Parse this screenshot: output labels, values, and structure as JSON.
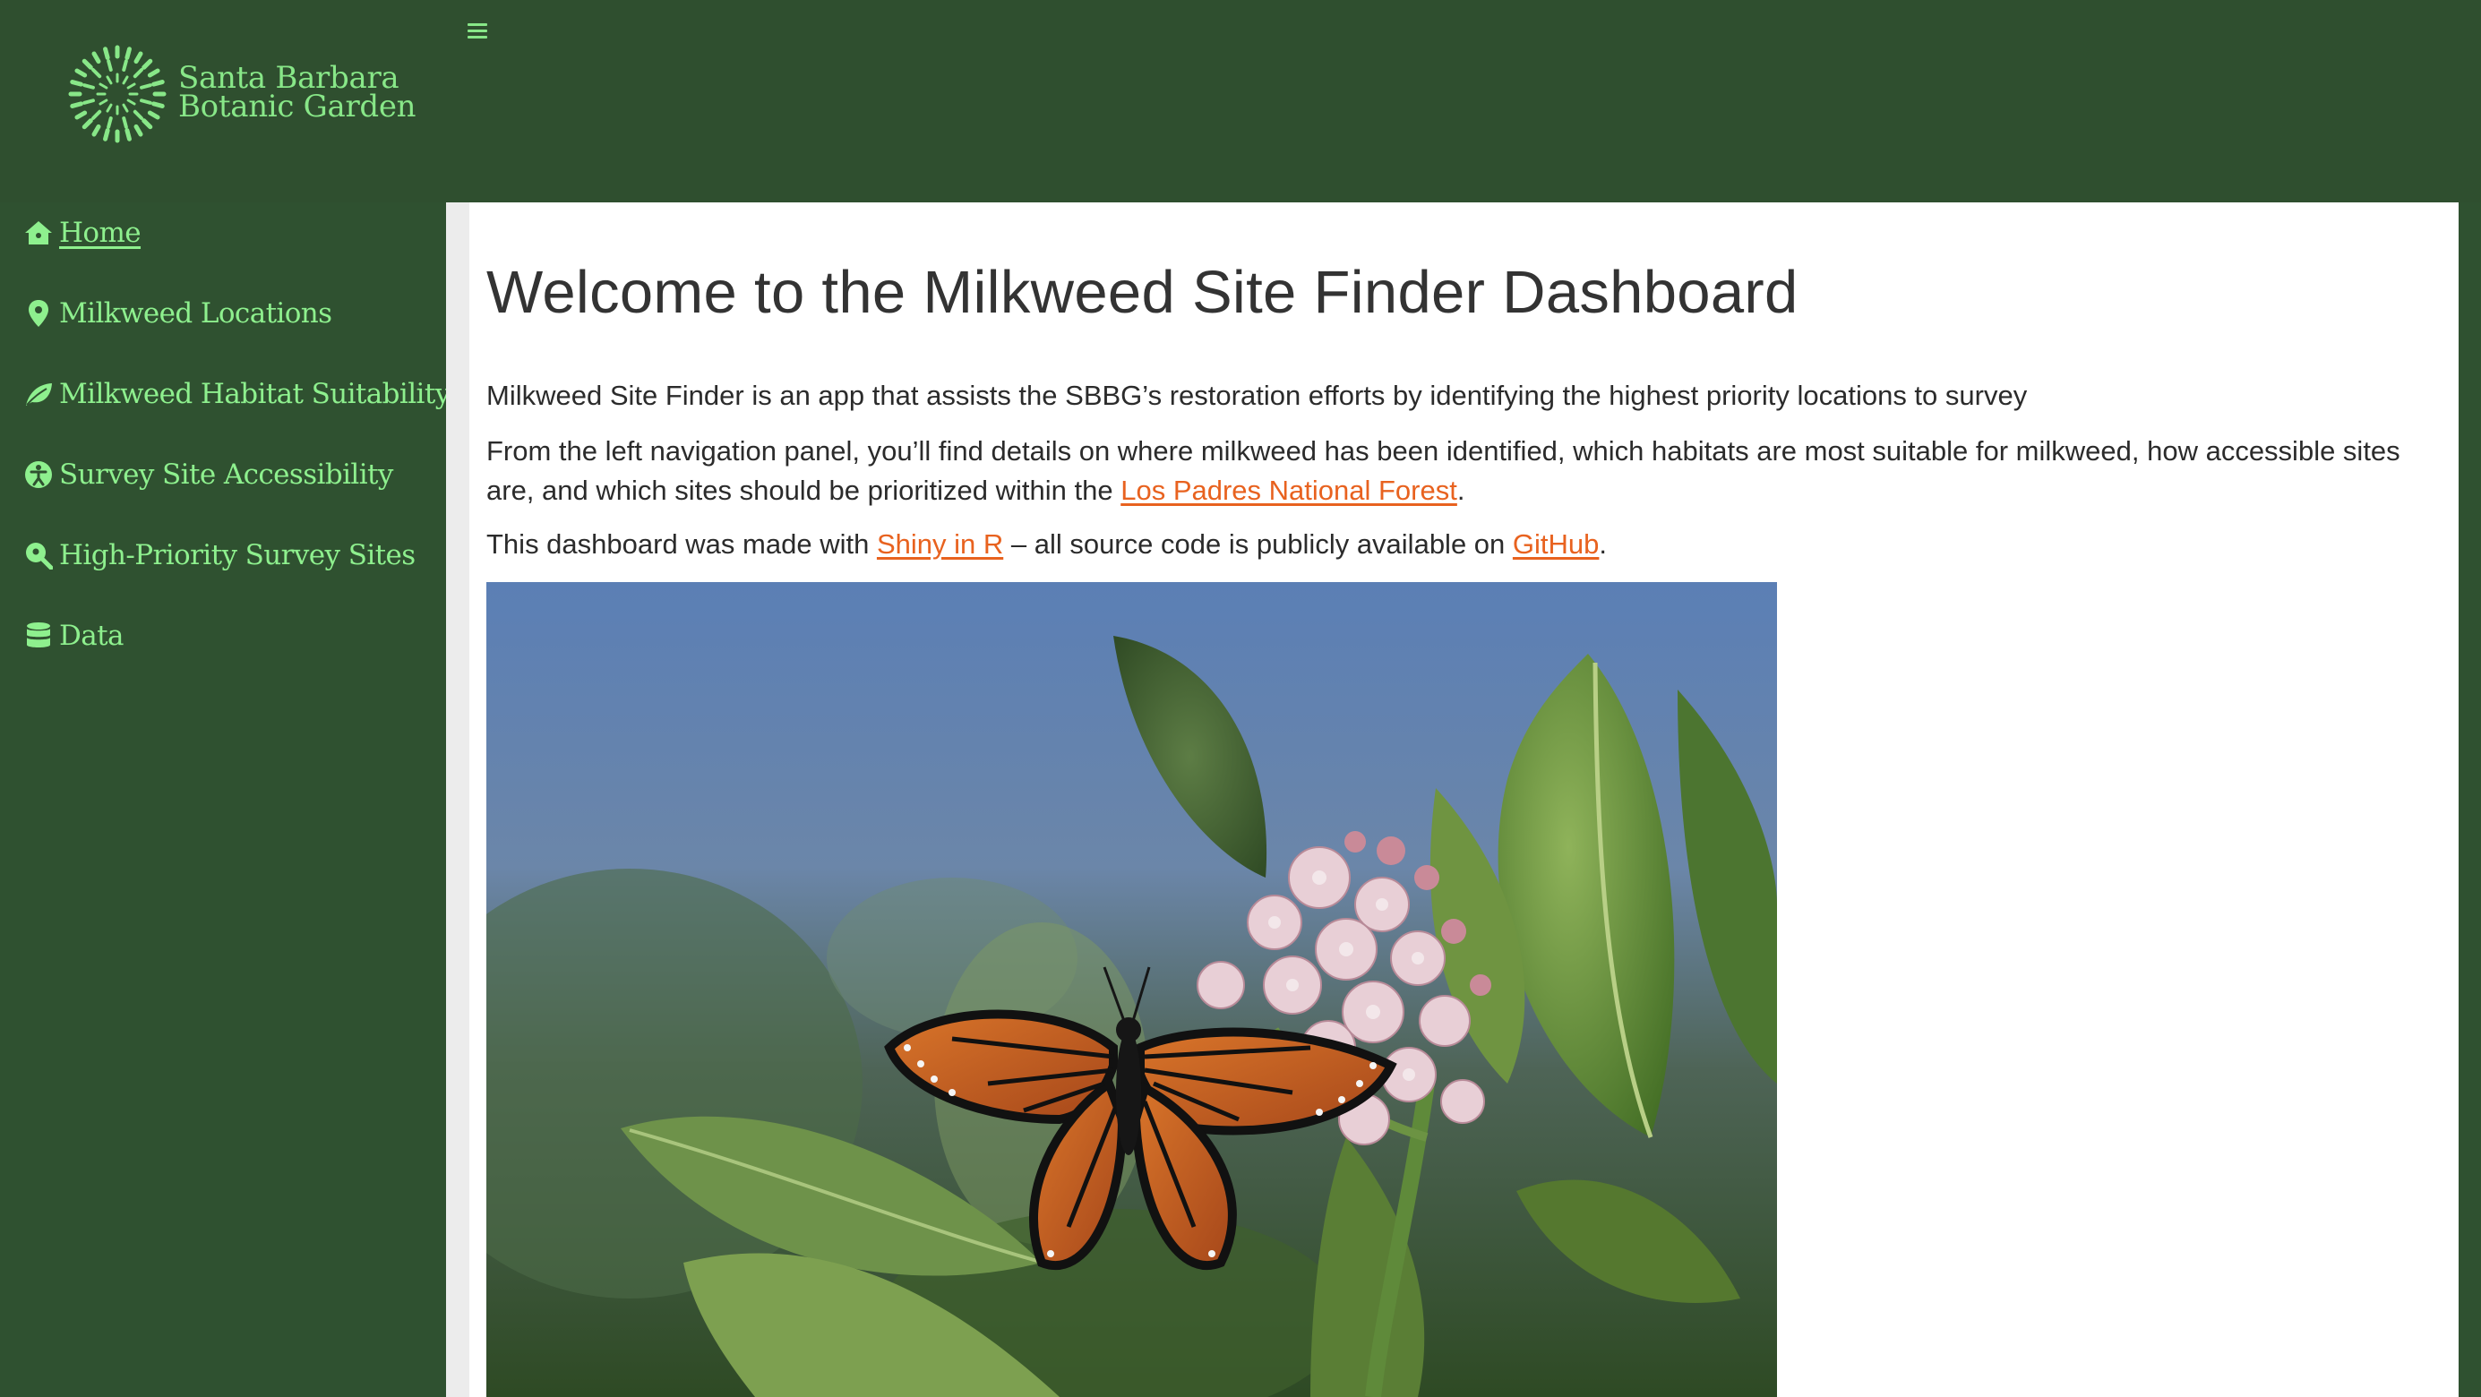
{
  "brand": {
    "name_line1": "Santa Barbara",
    "name_line2": "Botanic Garden",
    "accent": "#88e788",
    "header_bg": "#2f4f2f"
  },
  "header": {
    "menu_icon": "hamburger-icon"
  },
  "sidebar": {
    "items": [
      {
        "label": "Home",
        "icon": "home-icon",
        "active": true
      },
      {
        "label": "Milkweed Locations",
        "icon": "map-pin-icon",
        "active": false
      },
      {
        "label": "Milkweed Habitat Suitability",
        "icon": "leaf-icon",
        "active": false
      },
      {
        "label": "Survey Site Accessibility",
        "icon": "accessibility-icon",
        "active": false
      },
      {
        "label": "High-Priority Survey Sites",
        "icon": "search-location-icon",
        "active": false
      },
      {
        "label": "Data",
        "icon": "database-icon",
        "active": false
      }
    ]
  },
  "main": {
    "title": "Welcome to the Milkweed Site Finder Dashboard",
    "intro": "Milkweed Site Finder is an app that assists the SBBG’s restoration efforts by identifying the highest priority locations to survey",
    "nav_text_before": "From the left navigation panel, you’ll find details on where milkweed has been identified, which habitats are most suitable for milkweed, how accessible sites are, and which sites should be prioritized within the ",
    "nav_link": "Los Padres National Forest",
    "nav_text_after": ".",
    "made_text_before": "This dashboard was made with ",
    "made_link1": "Shiny in R",
    "made_text_middle": " – all source code is publicly available on ",
    "made_link2": "GitHub",
    "made_text_after": ".",
    "link_color": "#e8621f",
    "photo_subject": "monarch-butterfly-on-milkweed"
  }
}
